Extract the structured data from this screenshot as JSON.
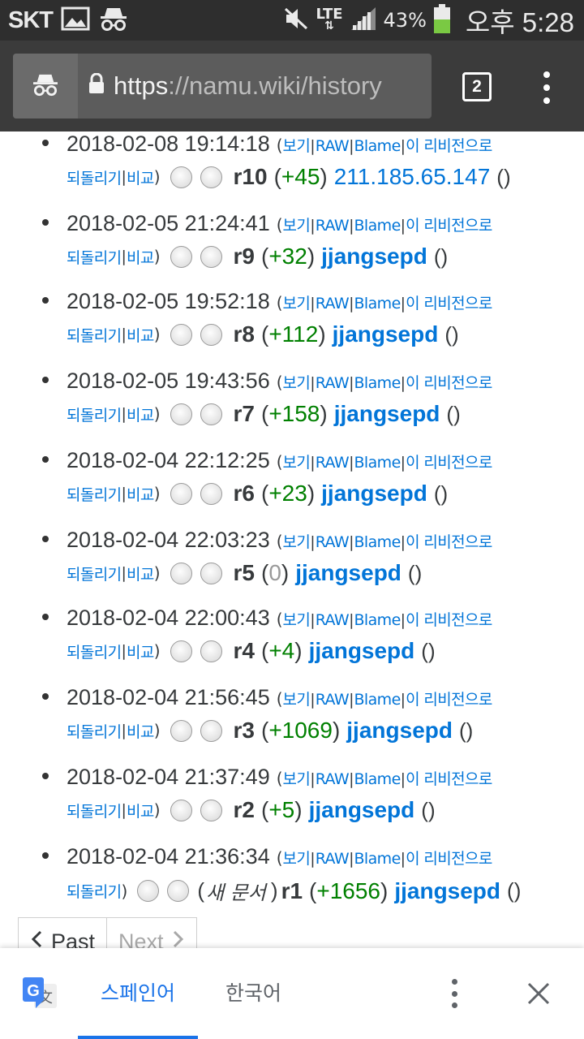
{
  "status_bar": {
    "carrier": "SKT",
    "network": "LTE",
    "battery_percent": "43%",
    "time": "오후 5:28",
    "colors": {
      "background": "#2e2e2e",
      "battery_fill": "#7ac943"
    },
    "icons": [
      "image-icon",
      "incognito-icon",
      "mute-icon",
      "data-arrows-icon",
      "signal-icon",
      "battery-icon"
    ]
  },
  "browser": {
    "url_scheme": "https",
    "url_rest": "://namu.wiki/history",
    "tab_count": "2",
    "icons": [
      "incognito-icon",
      "lock-icon",
      "menu-icon"
    ]
  },
  "history": {
    "link_labels": {
      "view": "보기",
      "raw": "RAW",
      "blame": "Blame",
      "revert_line1": "이 리비전으로",
      "revert_line2": "되돌리기",
      "compare": "비교"
    },
    "revisions": [
      {
        "date": "2018-02-08 19:14:18",
        "rev": "r10",
        "change": "+45",
        "user": "211.185.65.147"
      },
      {
        "date": "2018-02-05 21:24:41",
        "rev": "r9",
        "change": "+32",
        "user": "jjangsepd"
      },
      {
        "date": "2018-02-05 19:52:18",
        "rev": "r8",
        "change": "+112",
        "user": "jjangsepd"
      },
      {
        "date": "2018-02-05 19:43:56",
        "rev": "r7",
        "change": "+158",
        "user": "jjangsepd"
      },
      {
        "date": "2018-02-04 22:12:25",
        "rev": "r6",
        "change": "+23",
        "user": "jjangsepd"
      },
      {
        "date": "2018-02-04 22:03:23",
        "rev": "r5",
        "change": "0",
        "user": "jjangsepd"
      },
      {
        "date": "2018-02-04 22:00:43",
        "rev": "r4",
        "change": "+4",
        "user": "jjangsepd"
      },
      {
        "date": "2018-02-04 21:56:45",
        "rev": "r3",
        "change": "+1069",
        "user": "jjangsepd"
      },
      {
        "date": "2018-02-04 21:37:49",
        "rev": "r2",
        "change": "+5",
        "user": "jjangsepd"
      },
      {
        "date": "2018-02-04 21:36:34",
        "rev": "r1",
        "change": "+1656",
        "user": "jjangsepd",
        "note": "새 문서"
      }
    ],
    "colors": {
      "link": "#0275d8",
      "positive": "#008000",
      "zero": "#9a9a9a",
      "text": "#373a3c"
    }
  },
  "pager": {
    "past_label": "Past",
    "next_label": "Next"
  },
  "translate_bar": {
    "source_language": "스페인어",
    "target_language": "한국어",
    "colors": {
      "active": "#1a73e8",
      "inactive": "#5f6368"
    },
    "icons": [
      "google-translate-icon",
      "more-options-icon",
      "close-icon"
    ]
  }
}
